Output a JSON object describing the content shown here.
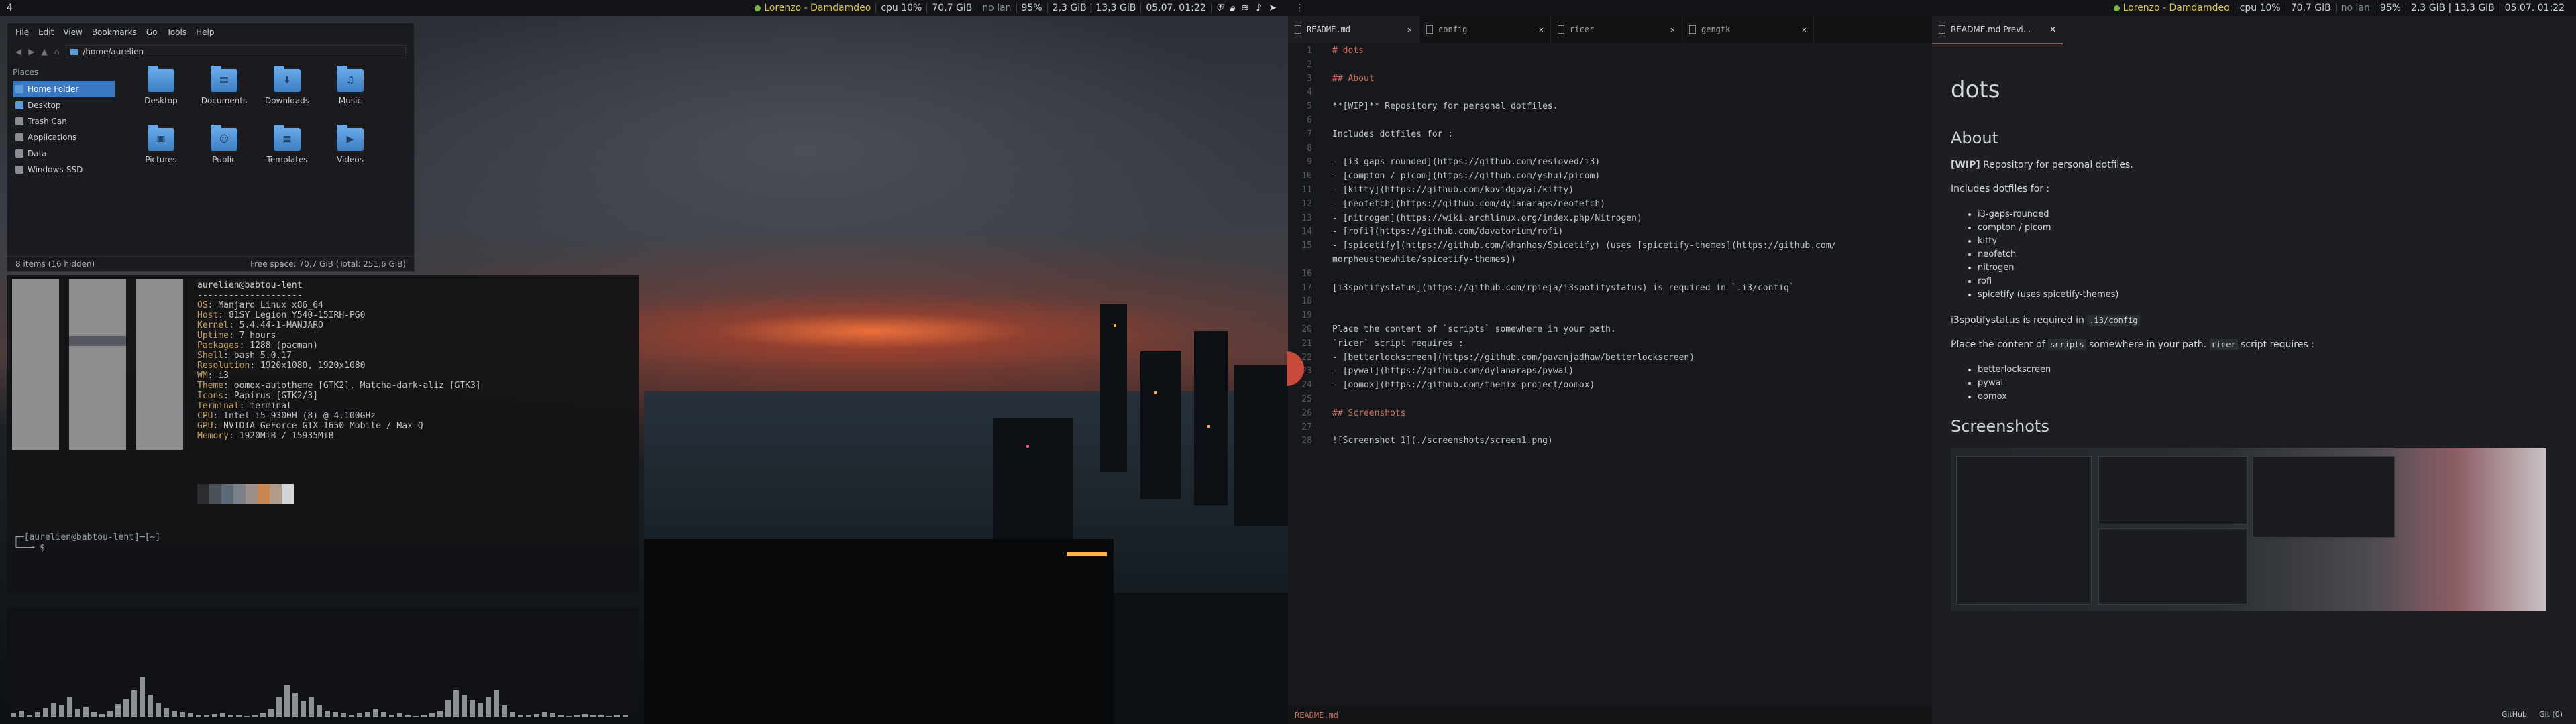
{
  "topbar": {
    "workspace_left": "4",
    "user": "Lorenzo - Damdamdeo",
    "cpu": "cpu   10%",
    "disk": "70,7 GiB",
    "lan": "no lan",
    "battery": "95%",
    "memory": "2,3 GiB | 13,3 GiB",
    "datetime": "05.07. 01:22",
    "tray_icons": [
      "shield-icon",
      "lock-icon",
      "wifi-icon",
      "volume-icon",
      "telegram-icon"
    ]
  },
  "filemanager": {
    "menu": [
      "File",
      "Edit",
      "View",
      "Bookmarks",
      "Go",
      "Tools",
      "Help"
    ],
    "location": "/home/aurelien",
    "places_heading": "Places",
    "places": [
      "Home Folder",
      "Desktop",
      "Trash Can",
      "Applications",
      "Data",
      "Windows-SSD"
    ],
    "items": [
      "Desktop",
      "Documents",
      "Downloads",
      "Music",
      "Pictures",
      "Public",
      "Templates",
      "Videos"
    ],
    "status_left": "8 items (16 hidden)",
    "status_right": "Free space: 70,7 GiB (Total: 251,6 GiB)"
  },
  "neofetch": {
    "userhost": "aurelien@babtou-lent",
    "separator": "--------------------",
    "lines": [
      {
        "k": "OS",
        "v": "Manjaro Linux x86_64"
      },
      {
        "k": "Host",
        "v": "81SY Legion Y540-15IRH-PG0"
      },
      {
        "k": "Kernel",
        "v": "5.4.44-1-MANJARO"
      },
      {
        "k": "Uptime",
        "v": "7 hours"
      },
      {
        "k": "Packages",
        "v": "1288 (pacman)"
      },
      {
        "k": "Shell",
        "v": "bash 5.0.17"
      },
      {
        "k": "Resolution",
        "v": "1920x1080, 1920x1080"
      },
      {
        "k": "WM",
        "v": "i3"
      },
      {
        "k": "Theme",
        "v": "oomox-autotheme [GTK2], Matcha-dark-aliz [GTK3]"
      },
      {
        "k": "Icons",
        "v": "Papirus [GTK2/3]"
      },
      {
        "k": "Terminal",
        "v": "terminal"
      },
      {
        "k": "CPU",
        "v": "Intel i5-9300H (8) @ 4.100GHz"
      },
      {
        "k": "GPU",
        "v": "NVIDIA GeForce GTX 1650 Mobile / Max-Q"
      },
      {
        "k": "Memory",
        "v": "1920MiB / 15935MiB"
      }
    ],
    "swatch_colors": [
      "#2b2d31",
      "#4a5058",
      "#5d6a78",
      "#7b7f88",
      "#9c8e88",
      "#c9874f",
      "#b39a86",
      "#d4d4d4"
    ],
    "prompt_line1": "┌─[aurelien@babtou-lent]─[~]",
    "prompt_line2": "└──╼ $"
  },
  "editor": {
    "tabs": [
      "README.md",
      "config",
      "ricer",
      "gengtk"
    ],
    "status_file": "README.md",
    "lines": [
      "# dots",
      "",
      "## About",
      "",
      "**[WIP]** Repository for personal dotfiles.",
      "",
      "Includes dotfiles for :",
      "",
      "- [i3-gaps-rounded](https://github.com/resloved/i3)",
      "- [compton / picom](https://github.com/yshui/picom)",
      "- [kitty](https://github.com/kovidgoyal/kitty)",
      "- [neofetch](https://github.com/dylanaraps/neofetch)",
      "- [nitrogen](https://wiki.archlinux.org/index.php/Nitrogen)",
      "- [rofi](https://github.com/davatorium/rofi)",
      "- [spicetify](https://github.com/khanhas/Spicetify) (uses [spicetify-themes](https://github.com/",
      "morpheusthewhite/spicetify-themes))",
      "",
      "[i3spotifystatus](https://github.com/rpieja/i3spotifystatus) is required in `.i3/config`",
      "",
      "",
      "Place the content of `scripts` somewhere in your path.",
      "`ricer` script requires :",
      "- [betterlockscreen](https://github.com/pavanjadhaw/betterlockscreen)",
      "- [pywal](https://github.com/dylanaraps/pywal)",
      "- [oomox](https://github.com/themix-project/oomox)",
      "",
      "## Screenshots",
      "",
      "![Screenshot 1](./screenshots/screen1.png)"
    ],
    "line_numbers": [
      "1",
      "2",
      "3",
      "4",
      "5",
      "6",
      "7",
      "8",
      "9",
      "10",
      "11",
      "12",
      "13",
      "14",
      "15",
      "",
      "16",
      "17",
      "18",
      "19",
      "20",
      "21",
      "22",
      "23",
      "24",
      "25",
      "26",
      "27",
      "28"
    ]
  },
  "preview": {
    "tab": "README.md Previ...",
    "title": "dots",
    "about": "About",
    "wip": "[WIP]",
    "wip_text": " Repository for personal dotfiles.",
    "includes": "Includes dotfiles for :",
    "list": [
      "i3-gaps-rounded",
      "compton / picom",
      "kitty",
      "neofetch",
      "nitrogen",
      "rofi",
      "spicetify (uses spicetify-themes)"
    ],
    "req_pre": "i3spotifystatus is required in ",
    "req_code": ".i3/config",
    "place_pre": "Place the content of ",
    "place_code1": "scripts",
    "place_mid": " somewhere in your path. ",
    "place_code2": "ricer",
    "place_post": " script requires :",
    "list2": [
      "betterlockscreen",
      "pywal",
      "oomox"
    ],
    "screens": "Screenshots",
    "foot": [
      "GitHub",
      "Git (0)"
    ]
  }
}
